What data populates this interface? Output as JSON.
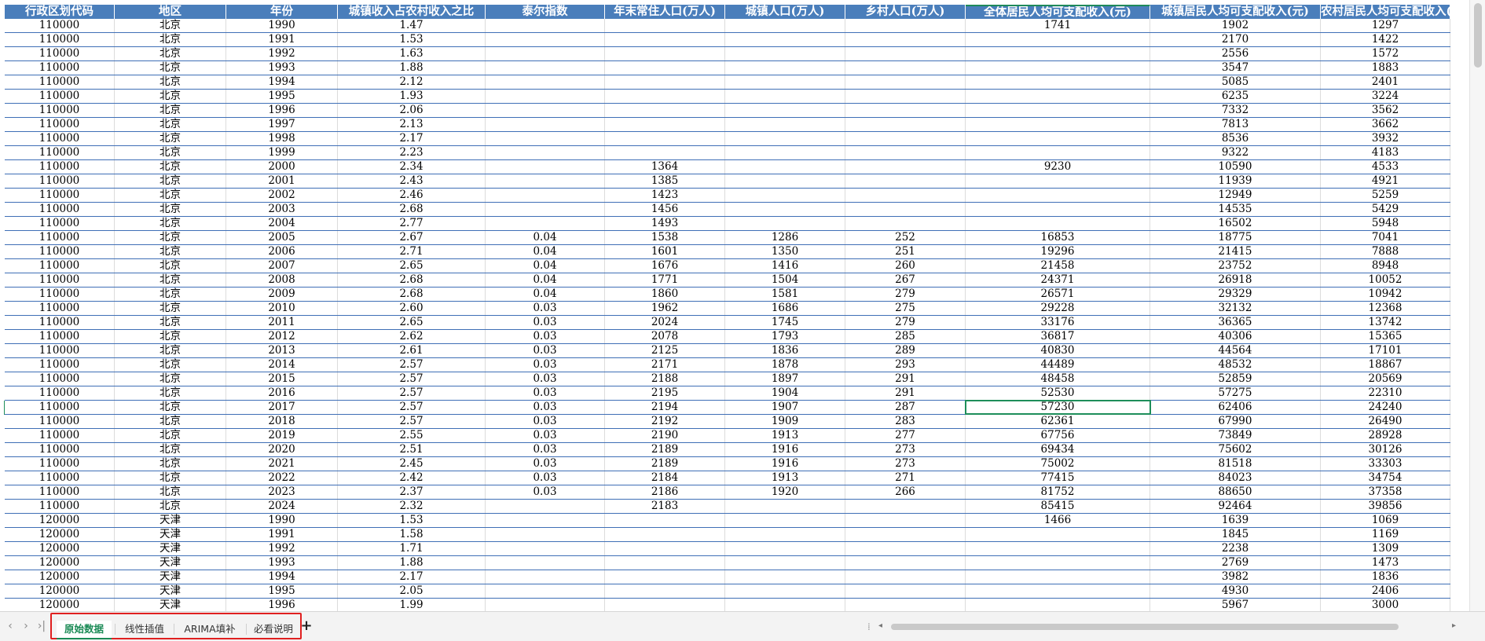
{
  "headers": [
    "行政区划代码",
    "地区",
    "年份",
    "城镇收入占农村收入之比",
    "泰尔指数",
    "年末常住人口(万人)",
    "城镇人口(万人)",
    "乡村人口(万人)",
    "全体居民人均可支配收入(元)",
    "城镇居民人均可支配收入(元)",
    "农村居民人均可支配收入(元"
  ],
  "rows": [
    [
      "110000",
      "北京",
      "1990",
      "1.47",
      "",
      "",
      "",
      "",
      "1741",
      "1902",
      "1297"
    ],
    [
      "110000",
      "北京",
      "1991",
      "1.53",
      "",
      "",
      "",
      "",
      "",
      "2170",
      "1422"
    ],
    [
      "110000",
      "北京",
      "1992",
      "1.63",
      "",
      "",
      "",
      "",
      "",
      "2556",
      "1572"
    ],
    [
      "110000",
      "北京",
      "1993",
      "1.88",
      "",
      "",
      "",
      "",
      "",
      "3547",
      "1883"
    ],
    [
      "110000",
      "北京",
      "1994",
      "2.12",
      "",
      "",
      "",
      "",
      "",
      "5085",
      "2401"
    ],
    [
      "110000",
      "北京",
      "1995",
      "1.93",
      "",
      "",
      "",
      "",
      "",
      "6235",
      "3224"
    ],
    [
      "110000",
      "北京",
      "1996",
      "2.06",
      "",
      "",
      "",
      "",
      "",
      "7332",
      "3562"
    ],
    [
      "110000",
      "北京",
      "1997",
      "2.13",
      "",
      "",
      "",
      "",
      "",
      "7813",
      "3662"
    ],
    [
      "110000",
      "北京",
      "1998",
      "2.17",
      "",
      "",
      "",
      "",
      "",
      "8536",
      "3932"
    ],
    [
      "110000",
      "北京",
      "1999",
      "2.23",
      "",
      "",
      "",
      "",
      "",
      "9322",
      "4183"
    ],
    [
      "110000",
      "北京",
      "2000",
      "2.34",
      "",
      "1364",
      "",
      "",
      "9230",
      "10590",
      "4533"
    ],
    [
      "110000",
      "北京",
      "2001",
      "2.43",
      "",
      "1385",
      "",
      "",
      "",
      "11939",
      "4921"
    ],
    [
      "110000",
      "北京",
      "2002",
      "2.46",
      "",
      "1423",
      "",
      "",
      "",
      "12949",
      "5259"
    ],
    [
      "110000",
      "北京",
      "2003",
      "2.68",
      "",
      "1456",
      "",
      "",
      "",
      "14535",
      "5429"
    ],
    [
      "110000",
      "北京",
      "2004",
      "2.77",
      "",
      "1493",
      "",
      "",
      "",
      "16502",
      "5948"
    ],
    [
      "110000",
      "北京",
      "2005",
      "2.67",
      "0.04",
      "1538",
      "1286",
      "252",
      "16853",
      "18775",
      "7041"
    ],
    [
      "110000",
      "北京",
      "2006",
      "2.71",
      "0.04",
      "1601",
      "1350",
      "251",
      "19296",
      "21415",
      "7888"
    ],
    [
      "110000",
      "北京",
      "2007",
      "2.65",
      "0.04",
      "1676",
      "1416",
      "260",
      "21458",
      "23752",
      "8948"
    ],
    [
      "110000",
      "北京",
      "2008",
      "2.68",
      "0.04",
      "1771",
      "1504",
      "267",
      "24371",
      "26918",
      "10052"
    ],
    [
      "110000",
      "北京",
      "2009",
      "2.68",
      "0.04",
      "1860",
      "1581",
      "279",
      "26571",
      "29329",
      "10942"
    ],
    [
      "110000",
      "北京",
      "2010",
      "2.60",
      "0.03",
      "1962",
      "1686",
      "275",
      "29228",
      "32132",
      "12368"
    ],
    [
      "110000",
      "北京",
      "2011",
      "2.65",
      "0.03",
      "2024",
      "1745",
      "279",
      "33176",
      "36365",
      "13742"
    ],
    [
      "110000",
      "北京",
      "2012",
      "2.62",
      "0.03",
      "2078",
      "1793",
      "285",
      "36817",
      "40306",
      "15365"
    ],
    [
      "110000",
      "北京",
      "2013",
      "2.61",
      "0.03",
      "2125",
      "1836",
      "289",
      "40830",
      "44564",
      "17101"
    ],
    [
      "110000",
      "北京",
      "2014",
      "2.57",
      "0.03",
      "2171",
      "1878",
      "293",
      "44489",
      "48532",
      "18867"
    ],
    [
      "110000",
      "北京",
      "2015",
      "2.57",
      "0.03",
      "2188",
      "1897",
      "291",
      "48458",
      "52859",
      "20569"
    ],
    [
      "110000",
      "北京",
      "2016",
      "2.57",
      "0.03",
      "2195",
      "1904",
      "291",
      "52530",
      "57275",
      "22310"
    ],
    [
      "110000",
      "北京",
      "2017",
      "2.57",
      "0.03",
      "2194",
      "1907",
      "287",
      "57230",
      "62406",
      "24240"
    ],
    [
      "110000",
      "北京",
      "2018",
      "2.57",
      "0.03",
      "2192",
      "1909",
      "283",
      "62361",
      "67990",
      "26490"
    ],
    [
      "110000",
      "北京",
      "2019",
      "2.55",
      "0.03",
      "2190",
      "1913",
      "277",
      "67756",
      "73849",
      "28928"
    ],
    [
      "110000",
      "北京",
      "2020",
      "2.51",
      "0.03",
      "2189",
      "1916",
      "273",
      "69434",
      "75602",
      "30126"
    ],
    [
      "110000",
      "北京",
      "2021",
      "2.45",
      "0.03",
      "2189",
      "1916",
      "273",
      "75002",
      "81518",
      "33303"
    ],
    [
      "110000",
      "北京",
      "2022",
      "2.42",
      "0.03",
      "2184",
      "1913",
      "271",
      "77415",
      "84023",
      "34754"
    ],
    [
      "110000",
      "北京",
      "2023",
      "2.37",
      "0.03",
      "2186",
      "1920",
      "266",
      "81752",
      "88650",
      "37358"
    ],
    [
      "110000",
      "北京",
      "2024",
      "2.32",
      "",
      "2183",
      "",
      "",
      "85415",
      "92464",
      "39856"
    ],
    [
      "120000",
      "天津",
      "1990",
      "1.53",
      "",
      "",
      "",
      "",
      "1466",
      "1639",
      "1069"
    ],
    [
      "120000",
      "天津",
      "1991",
      "1.58",
      "",
      "",
      "",
      "",
      "",
      "1845",
      "1169"
    ],
    [
      "120000",
      "天津",
      "1992",
      "1.71",
      "",
      "",
      "",
      "",
      "",
      "2238",
      "1309"
    ],
    [
      "120000",
      "天津",
      "1993",
      "1.88",
      "",
      "",
      "",
      "",
      "",
      "2769",
      "1473"
    ],
    [
      "120000",
      "天津",
      "1994",
      "2.17",
      "",
      "",
      "",
      "",
      "",
      "3982",
      "1836"
    ],
    [
      "120000",
      "天津",
      "1995",
      "2.05",
      "",
      "",
      "",
      "",
      "",
      "4930",
      "2406"
    ],
    [
      "120000",
      "天津",
      "1996",
      "1.99",
      "",
      "",
      "",
      "",
      "",
      "5967",
      "3000"
    ]
  ],
  "selected_cell": {
    "row": 27,
    "col": 8
  },
  "sheet_tabs": [
    {
      "label": "原始数据",
      "active": true
    },
    {
      "label": "线性插值",
      "active": false
    },
    {
      "label": "ARIMA填补",
      "active": false
    },
    {
      "label": "必看说明",
      "active": false
    }
  ],
  "nav_glyphs": {
    "prev": "‹",
    "next": "›",
    "last": "›|",
    "add": "+",
    "scroll_left": "◂",
    "scroll_right": "▸"
  },
  "colors": {
    "header_bg": "#4a7ebb",
    "row_border": "#3f6fb6",
    "selection": "#1e8e5a",
    "tab_highlight": "#e02020"
  }
}
